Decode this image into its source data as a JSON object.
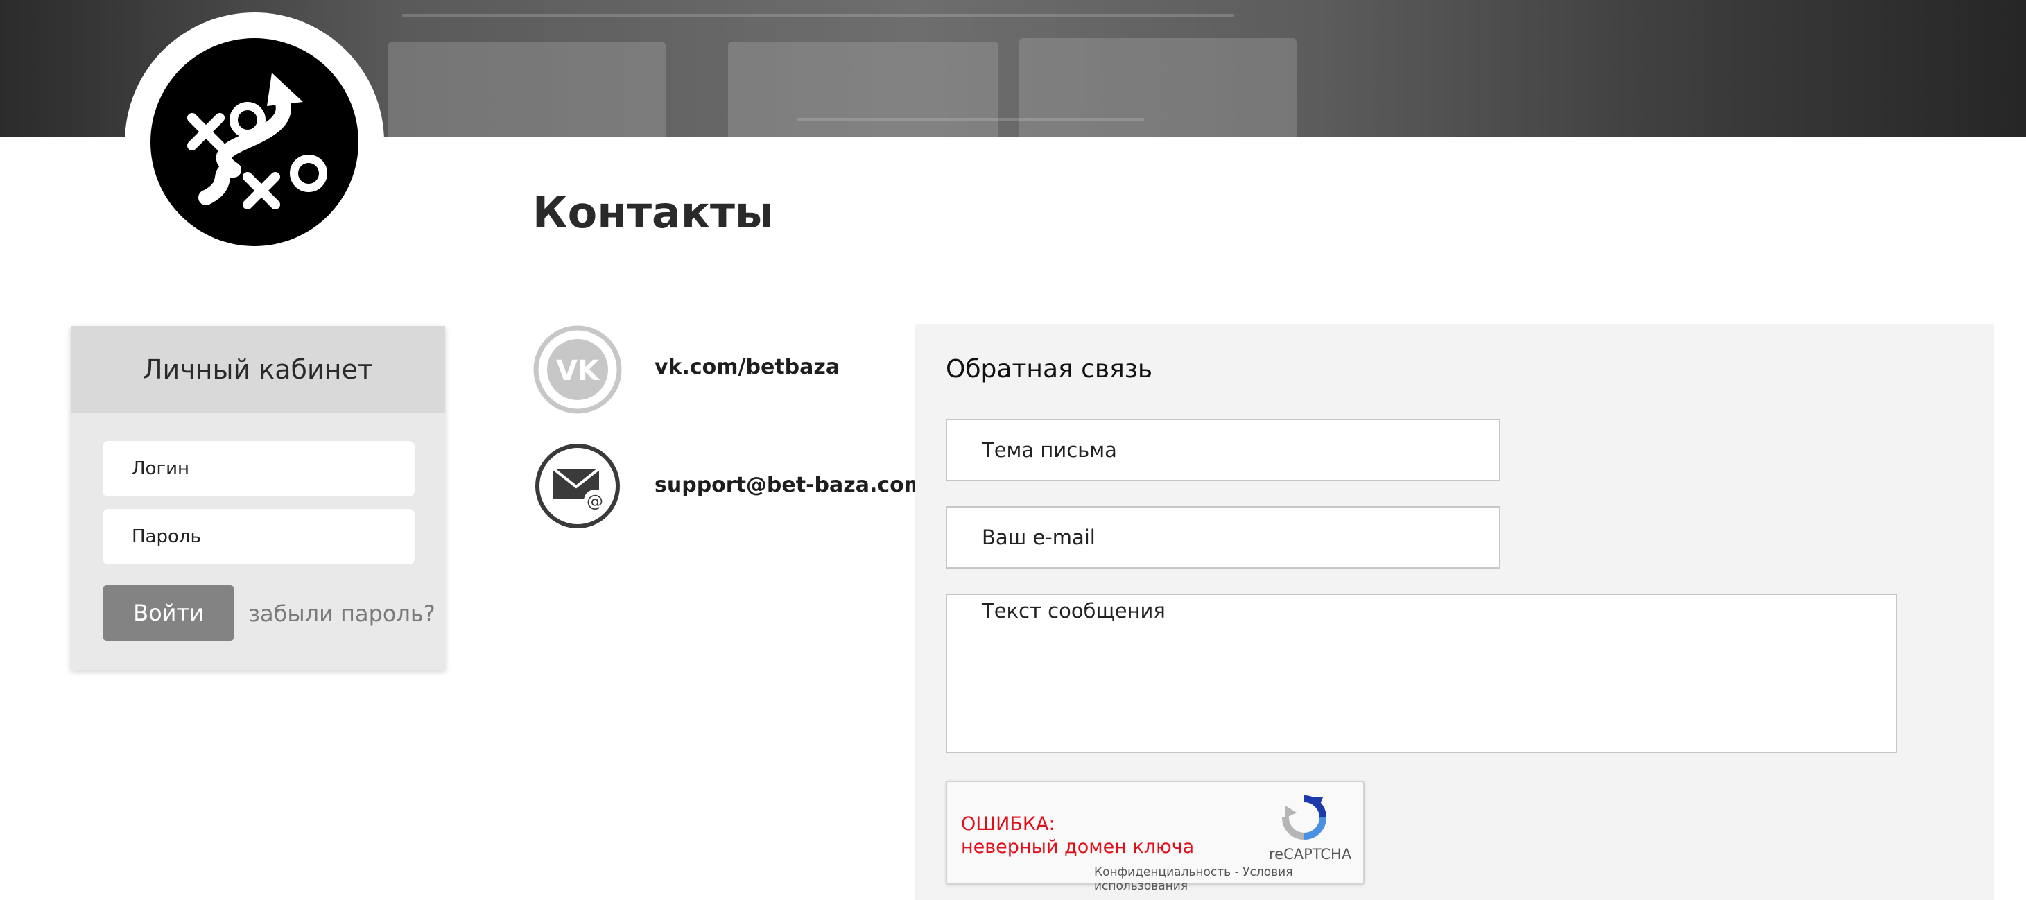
{
  "header": {
    "logo_icon": "tactics-xo-arrow-icon"
  },
  "page": {
    "title": "Контакты"
  },
  "login": {
    "title": "Личный кабинет",
    "login_placeholder": "Логин",
    "password_placeholder": "Пароль",
    "submit_label": "Войти",
    "forgot_label": "забыли пароль?"
  },
  "contacts": {
    "items": [
      {
        "icon": "vk-icon",
        "text": "vk.com/betbaza"
      },
      {
        "icon": "mail-icon",
        "text": "support@bet-baza.com"
      }
    ]
  },
  "feedback": {
    "title": "Обратная связь",
    "subject_placeholder": "Тема письма",
    "email_placeholder": "Ваш e-mail",
    "message_placeholder": "Текст сообщения"
  },
  "captcha": {
    "error_line1": "ОШИБКА:",
    "error_line2": "неверный домен ключа",
    "brand": "reCAPTCHA",
    "privacy": "Конфиденциальность",
    "separator": "-",
    "terms": "Условия использования",
    "error_color": "#e0101a"
  }
}
